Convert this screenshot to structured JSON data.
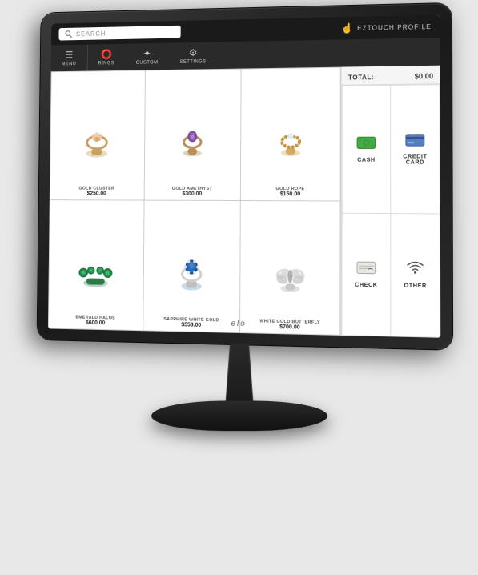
{
  "monitor": {
    "brand": "elo"
  },
  "topBar": {
    "searchPlaceholder": "SEARCH",
    "eztouchLabel": "EZTOUCH PROFILE"
  },
  "navBar": {
    "items": [
      {
        "id": "menu",
        "label": "MENU",
        "icon": "☰"
      },
      {
        "id": "rings",
        "label": "RINGS",
        "icon": "💍"
      },
      {
        "id": "custom",
        "label": "CUSTOM",
        "icon": "🎨"
      },
      {
        "id": "settings",
        "label": "SETTINGS",
        "icon": "⚙️"
      }
    ]
  },
  "products": [
    {
      "id": "gold-cluster",
      "name": "GOLD CLUSTER",
      "price": "$250.00",
      "emoji": "💍",
      "color": "#c8a060"
    },
    {
      "id": "gold-amethyst",
      "name": "GOLD AMETHYST",
      "price": "$300.00",
      "emoji": "💍",
      "color": "#b8905a"
    },
    {
      "id": "gold-rope",
      "name": "GOLD ROPE",
      "price": "$150.00",
      "emoji": "💍",
      "color": "#d4a860"
    },
    {
      "id": "emerald-halos",
      "name": "EMERALD HALOS",
      "price": "$600.00",
      "emoji": "💍",
      "color": "#4a9e6a"
    },
    {
      "id": "sapphire-white-gold",
      "name": "SAPPHIRE WHITE GOLD",
      "price": "$550.00",
      "emoji": "💍",
      "color": "#5a9ec0"
    },
    {
      "id": "white-gold-butterfly",
      "name": "WHITE GOLD BUTTERFLY",
      "price": "$700.00",
      "emoji": "🦋",
      "color": "#c0c0c0"
    }
  ],
  "payment": {
    "totalLabel": "TOTAL:",
    "totalAmount": "$0.00",
    "buttons": [
      {
        "id": "cash",
        "label": "CASH",
        "icon": "💵"
      },
      {
        "id": "credit-card",
        "label": "CREDIT CARD",
        "icon": "💳"
      },
      {
        "id": "check",
        "label": "CHECK",
        "icon": "📝"
      },
      {
        "id": "other",
        "label": "OTHER",
        "icon": "📶"
      }
    ]
  }
}
